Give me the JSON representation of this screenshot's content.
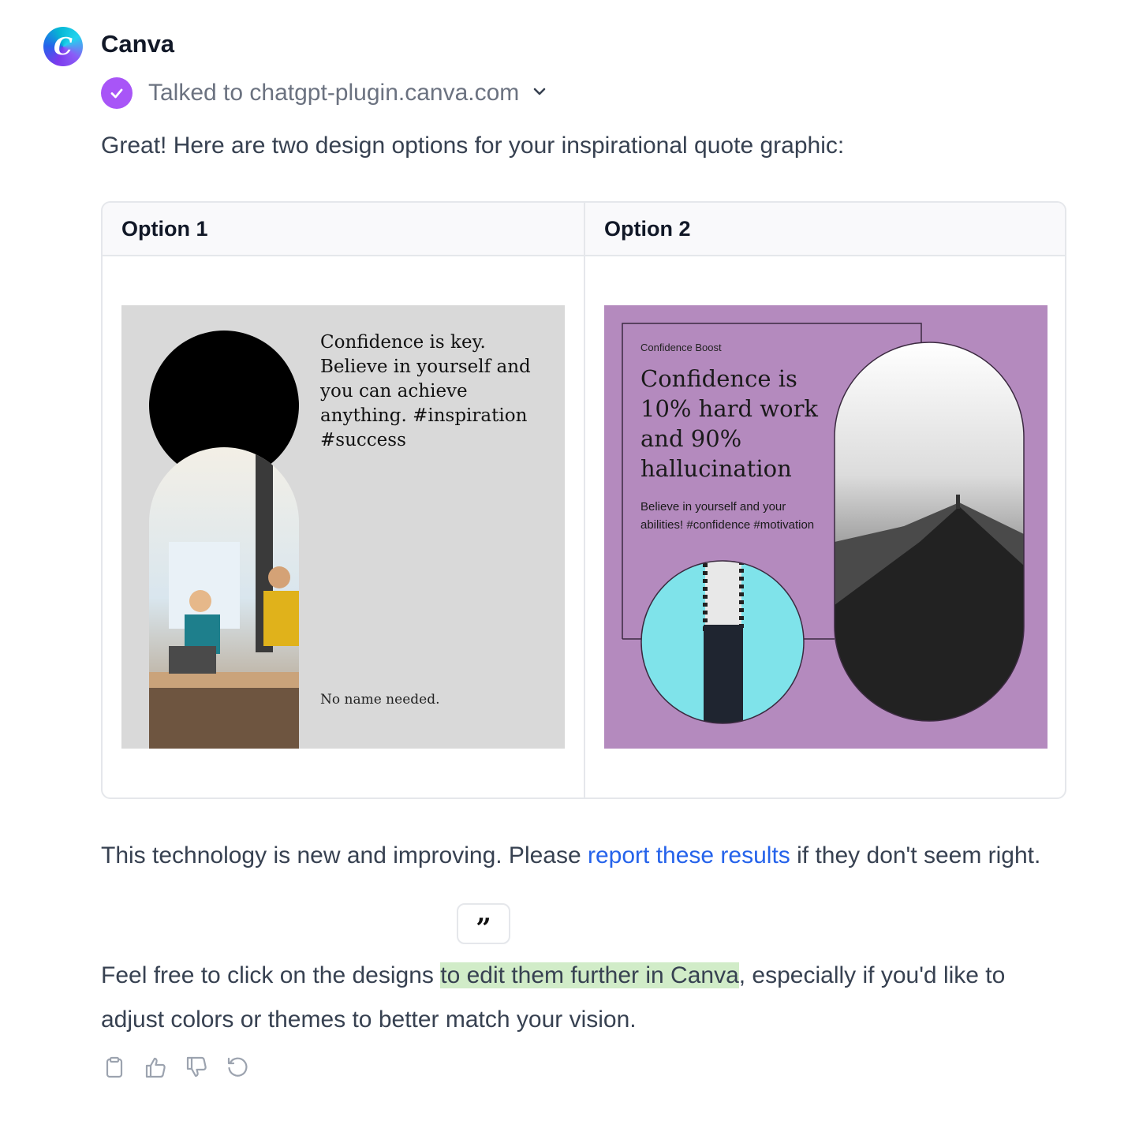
{
  "message": {
    "sender": "Canva",
    "avatar_letter": "C",
    "plugin_status": "Talked to chatgpt-plugin.canva.com",
    "intro": "Great! Here are two design options for your inspirational quote graphic:"
  },
  "table": {
    "headers": [
      "Option 1",
      "Option 2"
    ],
    "design1": {
      "quote": "Confidence is key. Believe in yourself and you can achieve anything. #inspiration #success",
      "footer": "No name needed."
    },
    "design2": {
      "label": "Confidence Boost",
      "quote": "Confidence is 10% hard work and 90% hallucination",
      "body": "Believe in yourself and your abilities! #confidence #motivation"
    }
  },
  "disclaimer": {
    "before": "This technology is new and improving. Please ",
    "link": "report these results",
    "after": " if they don't seem right."
  },
  "closing": {
    "before": "Feel free to click on the designs ",
    "highlight": "to edit them further in Canva",
    "after": ", especially if you'd like to adjust colors or themes to better match your vision."
  },
  "quote_button_glyph": "”",
  "icons": [
    "clipboard-icon",
    "thumbs-up-icon",
    "thumbs-down-icon",
    "regenerate-icon"
  ],
  "colors": {
    "accent_check": "#a855f7",
    "link": "#2563eb",
    "highlight": "#d1ecc8",
    "design2_bg": "#b48abe"
  }
}
